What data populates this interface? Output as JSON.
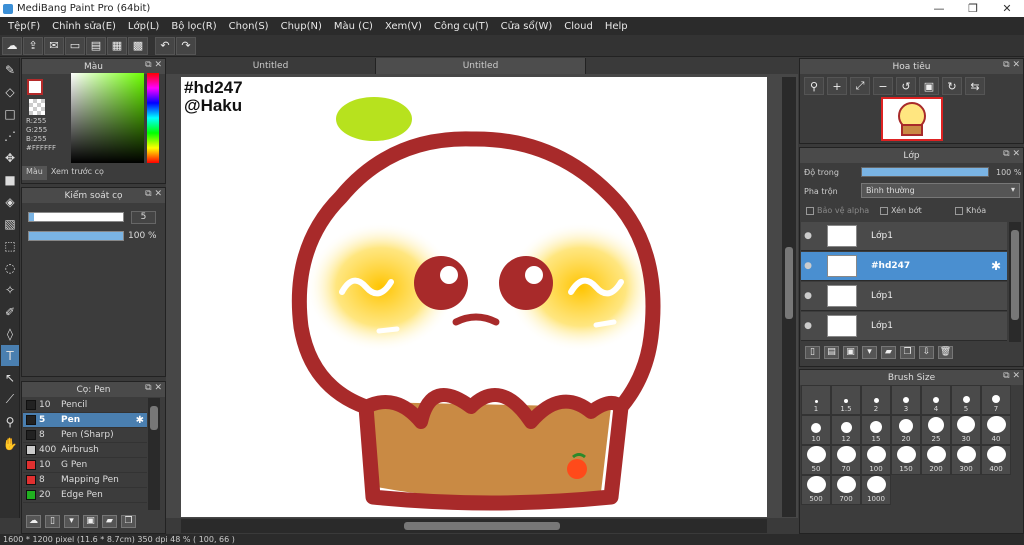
{
  "window": {
    "title": "MediBang Paint Pro (64bit)",
    "min": "—",
    "max": "❐",
    "close": "✕"
  },
  "menu": [
    "Tệp(F)",
    "Chỉnh sửa(E)",
    "Lớp(L)",
    "Bộ lọc(R)",
    "Chọn(S)",
    "Chụp(N)",
    "Màu (C)",
    "Xem(V)",
    "Công cụ(T)",
    "Cửa sổ(W)",
    "Cloud",
    "Help"
  ],
  "color_panel": {
    "title": "Màu",
    "r": "R:255",
    "g": "G:255",
    "b": "B:255",
    "hex": "#FFFFFF",
    "tab_color": "Màu",
    "tab_preview": "Xem trước cọ",
    "main_color": "#ffffff",
    "border_color": "#b52a2a"
  },
  "brush_control": {
    "title": "Kiểm soát cọ",
    "size_value": "5",
    "opacity_value": "100 %",
    "opacity_fraction": 1.0,
    "size_fraction": 0.05
  },
  "brush_panel": {
    "title": "Cọ: Pen",
    "items": [
      {
        "size": "10",
        "name": "Pencil",
        "color": "#222222"
      },
      {
        "size": "5",
        "name": "Pen",
        "color": "#222222",
        "selected": true
      },
      {
        "size": "8",
        "name": "Pen (Sharp)",
        "color": "#222222"
      },
      {
        "size": "400",
        "name": "Airbrush",
        "color": "#cccccc"
      },
      {
        "size": "10",
        "name": "G Pen",
        "color": "#e03030"
      },
      {
        "size": "8",
        "name": "Mapping Pen",
        "color": "#e03030"
      },
      {
        "size": "20",
        "name": "Edge Pen",
        "color": "#20b020"
      }
    ]
  },
  "doc_tabs": [
    "Untitled",
    "Untitled"
  ],
  "canvas": {
    "watermark_line1": "#hd247",
    "watermark_line2": "@Haku"
  },
  "navigator": {
    "title": "Hoa tiêu"
  },
  "layer_panel": {
    "title": "Lớp",
    "opacity_label": "Độ trong",
    "opacity_value": "100 %",
    "opacity_fraction": 1.0,
    "blend_label": "Pha trộn",
    "blend_value": "Bình thường",
    "protect_alpha": "Bảo vệ alpha",
    "clip": "Xén bớt",
    "lock": "Khóa",
    "layers": [
      {
        "name": "Lớp1"
      },
      {
        "name": "#hd247",
        "selected": true
      },
      {
        "name": "Lớp1"
      },
      {
        "name": "Lớp1"
      }
    ]
  },
  "brush_size": {
    "title": "Brush Size",
    "sizes": [
      "1",
      "1.5",
      "2",
      "3",
      "4",
      "5",
      "7",
      "10",
      "12",
      "15",
      "20",
      "25",
      "30",
      "40",
      "50",
      "70",
      "100",
      "150",
      "200",
      "300",
      "400",
      "500",
      "700",
      "1000"
    ]
  },
  "status": "1600 * 1200 pixel   (11.6 * 8.7cm)   350 dpi   48 %   ( 100, 66 )"
}
